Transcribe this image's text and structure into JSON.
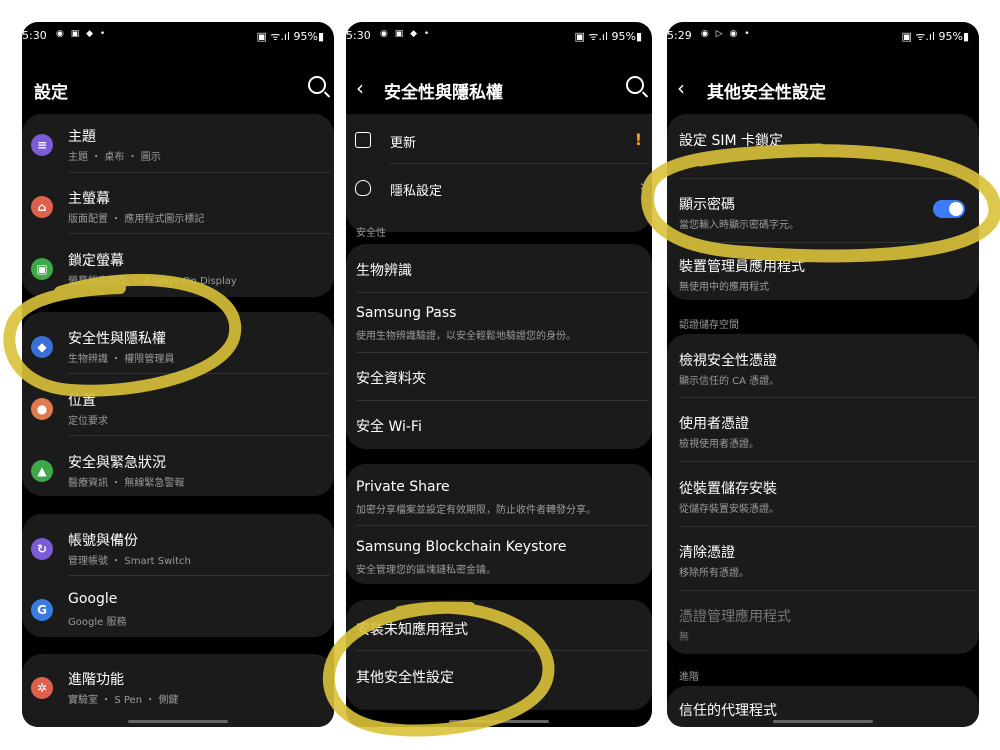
{
  "phone1": {
    "status": {
      "time": "5:30",
      "icons": "◉ ▣ ◆ •",
      "right": "▣ ᯤ.ıl 95%▮"
    },
    "title": "設定",
    "items": [
      {
        "title": "主題",
        "sub": "主題 ・ 桌布 ・ 圖示"
      },
      {
        "title": "主螢幕",
        "sub": "版面配置 ・ 應用程式圖示標記"
      },
      {
        "title": "鎖定螢幕",
        "sub": "螢幕鎖定類型 ・ Always On Display"
      },
      {
        "title": "安全性與隱私權",
        "sub": "生物辨識 ・ 權限管理員"
      },
      {
        "title": "位置",
        "sub": "定位要求"
      },
      {
        "title": "安全與緊急狀況",
        "sub": "醫療資訊 ・ 無線緊急警報"
      },
      {
        "title": "帳號與備份",
        "sub": "管理帳號 ・ Smart Switch"
      },
      {
        "title": "Google",
        "sub": "Google 服務"
      },
      {
        "title": "進階功能",
        "sub": "實驗室 ・ S Pen ・ 側鍵"
      }
    ]
  },
  "phone2": {
    "status": {
      "time": "5:30",
      "icons": "◉ ▣ ◆ •",
      "right": "▣ ᯤ.ıl 95%▮"
    },
    "title": "安全性與隱私權",
    "top_items": [
      {
        "title": "更新",
        "badge": "!"
      },
      {
        "title": "隱私設定",
        "badge": "›"
      }
    ],
    "section": "安全性",
    "items": [
      {
        "title": "生物辨識",
        "sub": ""
      },
      {
        "title": "Samsung Pass",
        "sub": "使用生物辨識驗證，以安全輕鬆地驗證您的身份。"
      },
      {
        "title": "安全資料夾",
        "sub": ""
      },
      {
        "title": "安全 Wi-Fi",
        "sub": ""
      },
      {
        "title": "Private Share",
        "sub": "加密分享檔案並設定有效期限，防止收件者轉發分享。"
      },
      {
        "title": "Samsung Blockchain Keystore",
        "sub": "安全管理您的區塊鏈私密金鑰。"
      },
      {
        "title": "安裝未知應用程式",
        "sub": ""
      },
      {
        "title": "其他安全性設定",
        "sub": ""
      }
    ]
  },
  "phone3": {
    "status": {
      "time": "5:29",
      "icons": "◉ ▷ ◉ •",
      "right": "▣ ᯤ.ıl 95%▮"
    },
    "title": "其他安全性設定",
    "items_top": [
      {
        "title": "設定 SIM 卡鎖定",
        "sub": ""
      },
      {
        "title": "顯示密碼",
        "sub": "當您輸入時顯示密碼字元。",
        "toggle": true
      },
      {
        "title": "裝置管理員應用程式",
        "sub": "無使用中的應用程式"
      }
    ],
    "section1": "認證儲存空間",
    "items_cred": [
      {
        "title": "檢視安全性憑證",
        "sub": "顯示信任的 CA 憑證。"
      },
      {
        "title": "使用者憑證",
        "sub": "檢視使用者憑證。"
      },
      {
        "title": "從裝置儲存安裝",
        "sub": "從儲存裝置安裝憑證。"
      },
      {
        "title": "清除憑證",
        "sub": "移除所有憑證。"
      },
      {
        "title": "憑證管理應用程式",
        "sub": "無"
      }
    ],
    "section2": "進階",
    "items_adv": [
      {
        "title": "信任的代理程式",
        "sub": ""
      }
    ]
  },
  "colors": {
    "highlight": "#d9c23a",
    "toggle_on": "#3e7bff",
    "card_bg": "#1b1b1b"
  },
  "icons": {
    "theme": "paint-brush-icon",
    "home": "home-icon",
    "lock": "lock-icon",
    "shield": "shield-icon",
    "location": "location-pin-icon",
    "emergency": "emergency-icon",
    "sync": "sync-icon",
    "google": "google-icon",
    "advanced": "gear-icon"
  }
}
